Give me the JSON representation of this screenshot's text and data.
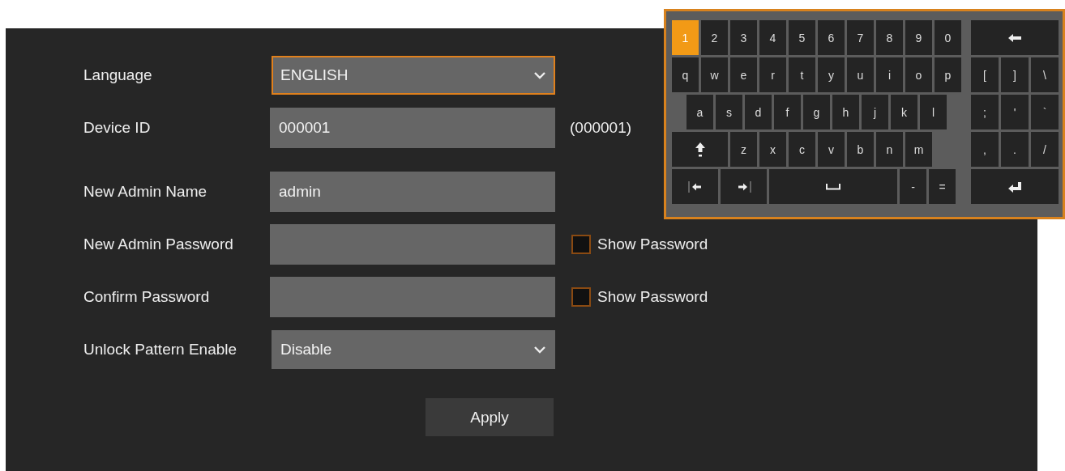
{
  "form": {
    "rows": [
      {
        "kind": "dropdown",
        "label": "Language",
        "value": "ENGLISH",
        "focused": true
      },
      {
        "kind": "text",
        "label": "Device ID",
        "value": "000001",
        "focused": false,
        "note": "(000001)"
      },
      {
        "kind": "text",
        "label": "New Admin Name",
        "value": "admin",
        "focused": false
      },
      {
        "kind": "password",
        "label": "New Admin Password",
        "focused": false,
        "toggle": {
          "label": "Show Password",
          "checked": false
        }
      },
      {
        "kind": "password",
        "label": "Confirm Password",
        "focused": false,
        "toggle": {
          "label": "Show Password",
          "checked": false
        }
      },
      {
        "kind": "dropdown",
        "label": "Unlock Pattern Enable",
        "value": "Disable",
        "focused": false
      }
    ],
    "apply": "Apply"
  },
  "keyboard": {
    "main_rows": [
      [
        {
          "kind": "char",
          "label": "1",
          "selected": true
        },
        {
          "kind": "char",
          "label": "2",
          "selected": false
        },
        {
          "kind": "char",
          "label": "3",
          "selected": false
        },
        {
          "kind": "char",
          "label": "4",
          "selected": false
        },
        {
          "kind": "char",
          "label": "5",
          "selected": false
        },
        {
          "kind": "char",
          "label": "6",
          "selected": false
        },
        {
          "kind": "char",
          "label": "7",
          "selected": false
        },
        {
          "kind": "char",
          "label": "8",
          "selected": false
        },
        {
          "kind": "char",
          "label": "9",
          "selected": false
        },
        {
          "kind": "char",
          "label": "0",
          "selected": false
        }
      ],
      [
        {
          "kind": "char",
          "label": "q",
          "selected": false
        },
        {
          "kind": "char",
          "label": "w",
          "selected": false
        },
        {
          "kind": "char",
          "label": "e",
          "selected": false
        },
        {
          "kind": "char",
          "label": "r",
          "selected": false
        },
        {
          "kind": "char",
          "label": "t",
          "selected": false
        },
        {
          "kind": "char",
          "label": "y",
          "selected": false
        },
        {
          "kind": "char",
          "label": "u",
          "selected": false
        },
        {
          "kind": "char",
          "label": "i",
          "selected": false
        },
        {
          "kind": "char",
          "label": "o",
          "selected": false
        },
        {
          "kind": "char",
          "label": "p",
          "selected": false
        }
      ],
      [
        {
          "kind": "char",
          "label": "a",
          "selected": false
        },
        {
          "kind": "char",
          "label": "s",
          "selected": false
        },
        {
          "kind": "char",
          "label": "d",
          "selected": false
        },
        {
          "kind": "char",
          "label": "f",
          "selected": false
        },
        {
          "kind": "char",
          "label": "g",
          "selected": false
        },
        {
          "kind": "char",
          "label": "h",
          "selected": false
        },
        {
          "kind": "char",
          "label": "j",
          "selected": false
        },
        {
          "kind": "char",
          "label": "k",
          "selected": false
        },
        {
          "kind": "char",
          "label": "l",
          "selected": false
        }
      ],
      [
        {
          "kind": "shift",
          "selected": false
        },
        {
          "kind": "char",
          "label": "z",
          "selected": false
        },
        {
          "kind": "char",
          "label": "x",
          "selected": false
        },
        {
          "kind": "char",
          "label": "c",
          "selected": false
        },
        {
          "kind": "char",
          "label": "v",
          "selected": false
        },
        {
          "kind": "char",
          "label": "b",
          "selected": false
        },
        {
          "kind": "char",
          "label": "n",
          "selected": false
        },
        {
          "kind": "char",
          "label": "m",
          "selected": false
        }
      ],
      [
        {
          "kind": "left",
          "selected": false
        },
        {
          "kind": "right",
          "selected": false
        },
        {
          "kind": "space",
          "selected": false
        },
        {
          "kind": "char",
          "label": "-",
          "selected": false
        },
        {
          "kind": "char",
          "label": "=",
          "selected": false
        }
      ]
    ],
    "side_rows": [
      [
        {
          "kind": "backspace",
          "selected": false
        }
      ],
      [
        {
          "kind": "char",
          "label": "[",
          "selected": false
        },
        {
          "kind": "char",
          "label": "]",
          "selected": false
        },
        {
          "kind": "char",
          "label": "\\",
          "selected": false
        }
      ],
      [
        {
          "kind": "char",
          "label": ";",
          "selected": false
        },
        {
          "kind": "char",
          "label": "'",
          "selected": false
        },
        {
          "kind": "char",
          "label": "`",
          "selected": false
        }
      ],
      [
        {
          "kind": "char",
          "label": ",",
          "selected": false
        },
        {
          "kind": "char",
          "label": ".",
          "selected": false
        },
        {
          "kind": "char",
          "label": "/",
          "selected": false
        }
      ],
      [
        {
          "kind": "enter",
          "selected": false
        }
      ]
    ]
  }
}
